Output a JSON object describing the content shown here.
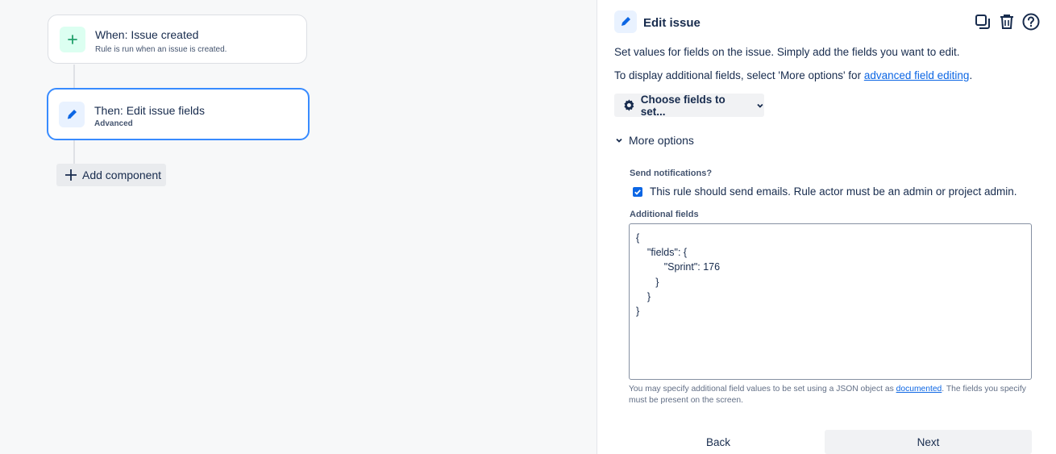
{
  "canvas": {
    "trigger": {
      "title": "When: Issue created",
      "subtitle": "Rule is run when an issue is created.",
      "icon": "plus-icon"
    },
    "action": {
      "title": "Then: Edit issue fields",
      "subtitle": "Advanced",
      "icon": "pencil-icon"
    },
    "add_component_label": "Add component"
  },
  "panel": {
    "title": "Edit issue",
    "description": "Set values for fields on the issue. Simply add the fields you want to edit.",
    "advanced_prefix": "To display additional fields, select 'More options' for ",
    "advanced_link": "advanced field editing",
    "advanced_suffix": ".",
    "choose_fields_label": "Choose fields to set...",
    "more_options_label": "More options",
    "send_notifications_label": "Send notifications?",
    "send_notifications_checked": true,
    "send_notifications_text": "This rule should send emails. Rule actor must be an admin or project admin.",
    "additional_fields_label": "Additional fields",
    "additional_fields_value": "{\n    \"fields\": {\n          \"Sprint\": 176\n       }\n    }\n}",
    "help_prefix": "You may specify additional field values to be set using a JSON object as ",
    "help_link": "documented",
    "help_suffix": ". The fields you specify must be present on the screen.",
    "back_label": "Back",
    "next_label": "Next"
  },
  "colors": {
    "accent": "#0c66e4",
    "selected_border": "#388bff",
    "trigger_icon_bg": "#dcfff1",
    "trigger_icon": "#22a06b"
  }
}
